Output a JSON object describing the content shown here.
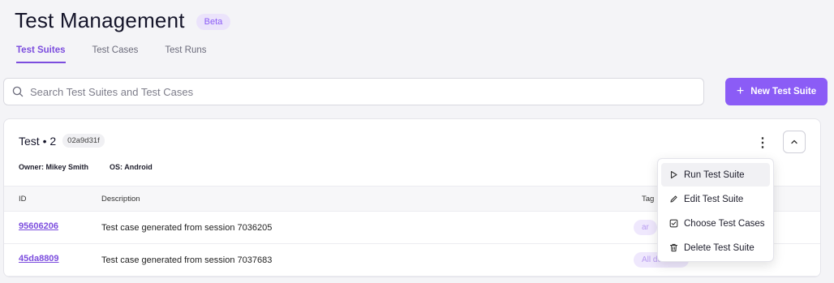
{
  "header": {
    "title": "Test Management",
    "badge": "Beta"
  },
  "tabs": [
    {
      "label": "Test Suites",
      "active": true
    },
    {
      "label": "Test Cases",
      "active": false
    },
    {
      "label": "Test Runs",
      "active": false
    }
  ],
  "search": {
    "placeholder": "Search Test Suites and Test Cases",
    "value": ""
  },
  "new_suite_button": {
    "label": "New Test Suite"
  },
  "suite": {
    "name": "Test • 2",
    "id_badge": "02a9d31f",
    "owner_label": "Owner:",
    "owner": "Mikey Smith",
    "os_label": "OS:",
    "os": "Android",
    "columns": {
      "id": "ID",
      "description": "Description",
      "tags": "Tag"
    },
    "rows": [
      {
        "id": "95606206",
        "description": "Test case generated from session 7036205",
        "tag": "ar"
      },
      {
        "id": "45da8809",
        "description": "Test case generated from session 7037683",
        "tag": "All devices"
      }
    ]
  },
  "menu": {
    "items": [
      {
        "label": "Run Test Suite",
        "icon": "play-icon"
      },
      {
        "label": "Edit Test Suite",
        "icon": "pencil-icon"
      },
      {
        "label": "Choose Test Cases",
        "icon": "checkbox-icon"
      },
      {
        "label": "Delete Test Suite",
        "icon": "trash-icon"
      }
    ]
  },
  "colors": {
    "accent": "#8b5cf6",
    "accent_text": "#7c4dde",
    "background": "#f4f4f7"
  }
}
